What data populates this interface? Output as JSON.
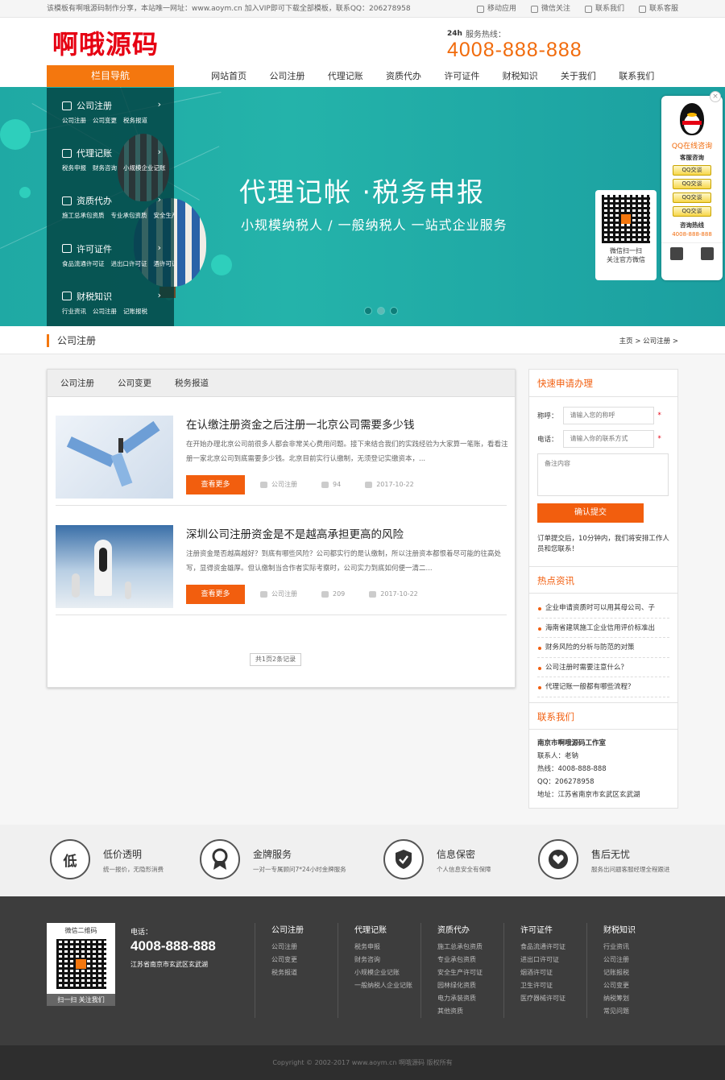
{
  "topbar": {
    "notice": "该模板有啊哦源码制作分享，本站唯一网址：www.aoym.cn 加入VIP即可下载全部模板，联系QQ：206278958",
    "links": [
      "移动应用",
      "微信关注",
      "联系我们",
      "联系客服"
    ]
  },
  "header": {
    "logo": "啊哦源码",
    "hotline_label": "服务热线：",
    "hotline_24": "24h",
    "hotline": "4008-888-888"
  },
  "nav": {
    "title": "栏目导航",
    "links": [
      "网站首页",
      "公司注册",
      "代理记账",
      "资质代办",
      "许可证件",
      "财税知识",
      "关于我们",
      "联系我们"
    ]
  },
  "sidenav": [
    {
      "title": "公司注册",
      "subs": [
        "公司注册",
        "公司变更",
        "税务报道"
      ]
    },
    {
      "title": "代理记账",
      "subs": [
        "税务申报",
        "财务咨询",
        "小规模企业记账"
      ]
    },
    {
      "title": "资质代办",
      "subs": [
        "施工总承包资质",
        "专业承包资质",
        "安全生产许可证"
      ]
    },
    {
      "title": "许可证件",
      "subs": [
        "食品流通许可证",
        "进出口许可证",
        "酒许可证"
      ]
    },
    {
      "title": "财税知识",
      "subs": [
        "行业资讯",
        "公司注册",
        "记账报税"
      ]
    }
  ],
  "banner": {
    "title": "代理记帐 ·税务申报",
    "subtitle": "小规模纳税人 / 一般纳税人   一站式企业服务",
    "qr_line1": "微信扫一扫",
    "qr_line2": "关注官方微信"
  },
  "qq": {
    "title": "QQ在线咨询",
    "service": "客服咨询",
    "btn": "QQ交谈",
    "btn_count": 4,
    "hotline_label": "咨询热线",
    "hotline": "4008-888-888"
  },
  "breadcrumb": {
    "current": "公司注册",
    "path": "主页 > 公司注册 >"
  },
  "main": {
    "tabs": [
      "公司注册",
      "公司变更",
      "税务报道"
    ],
    "articles": [
      {
        "title": "在认缴注册资金之后注册一北京公司需要多少钱",
        "desc": "在开始办理北京公司前很多人都会非常关心费用问题。接下来结合我们的实践经验为大家算一笔账，看看注册一家北京公司到底需要多少钱。北京目前实行认缴制，无须登记实缴资本，...",
        "more": "查看更多",
        "category": "公司注册",
        "views": "94",
        "date": "2017-10-22"
      },
      {
        "title": "深圳公司注册资金是不是越高承担更高的风险",
        "desc": "注册资金是否越高越好？到底有哪些风险？公司都实行的是认缴制，所以注册资本都恨着尽可能的往高处写，显得资金雄厚。但认缴制当合作者实际考察时，公司实力到底如何便一清二...",
        "more": "查看更多",
        "category": "公司注册",
        "views": "209",
        "date": "2017-10-22"
      }
    ],
    "pagination": "共1页2条记录"
  },
  "side": {
    "apply_title": "快速申请办理",
    "name_label": "称呼：",
    "name_placeholder": "请输入您的称呼",
    "phone_label": "电话：",
    "phone_placeholder": "请输入你的联系方式",
    "note_placeholder": "备注内容",
    "submit": "确认提交",
    "note": "订单提交后，10分钟内，我们将安排工作人员和您联系！",
    "hot_title": "热点资讯",
    "hot": [
      "企业申请资质时可以用其母公司、子",
      "海南省建筑施工企业信用评价标准出",
      "财务风险的分析与防范的对策",
      "公司注册时需要注意什么？",
      "代理记账一般都有哪些流程？"
    ],
    "contact_title": "联系我们",
    "company": "南京市啊哦源码工作室",
    "contact_person": "联系人：老钠",
    "contact_hotline": "热线：4008-888-888",
    "contact_qq": "QQ：206278958",
    "contact_addr": "地址：江苏省南京市玄武区玄武湖"
  },
  "features": [
    {
      "icon_text": "低",
      "title": "低价透明",
      "desc": "统一报价，无隐形消费"
    },
    {
      "icon_text": "",
      "title": "金牌服务",
      "desc": "一对一专属顾问7*24小时金牌服务"
    },
    {
      "icon_text": "",
      "title": "信息保密",
      "desc": "个人信息安全有保障"
    },
    {
      "icon_text": "",
      "title": "售后无忧",
      "desc": "服务出问题客服经理全程跟进"
    }
  ],
  "footer": {
    "qr_title": "微信二维码",
    "qr_scan": "扫一扫 关注我们",
    "phone_label": "电话：",
    "phone": "4008-888-888",
    "address": "江苏省南京市玄武区玄武湖",
    "cols": [
      {
        "title": "公司注册",
        "items": [
          "公司注册",
          "公司变更",
          "税务报道"
        ]
      },
      {
        "title": "代理记账",
        "items": [
          "税务申报",
          "财务咨询",
          "小规模企业记账",
          "一般纳税人企业记账"
        ]
      },
      {
        "title": "资质代办",
        "items": [
          "施工总承包资质",
          "专业承包资质",
          "安全生产许可证",
          "园林绿化资质",
          "电力承装资质",
          "其他资质"
        ]
      },
      {
        "title": "许可证件",
        "items": [
          "食品流通许可证",
          "进出口许可证",
          "烟酒许可证",
          "卫生许可证",
          "医疗器械许可证"
        ]
      },
      {
        "title": "财税知识",
        "items": [
          "行业资讯",
          "公司注册",
          "记账报税",
          "公司变更",
          "纳税筹划",
          "常见问题"
        ]
      }
    ],
    "copyright": "Copyright © 2002-2017 www.aoym.cn 啊哦源码 版权所有"
  },
  "colors": {
    "accent": "#f4770e",
    "button": "#f25e0e",
    "banner": "#22aea6",
    "footer": "#3d3d3d"
  }
}
